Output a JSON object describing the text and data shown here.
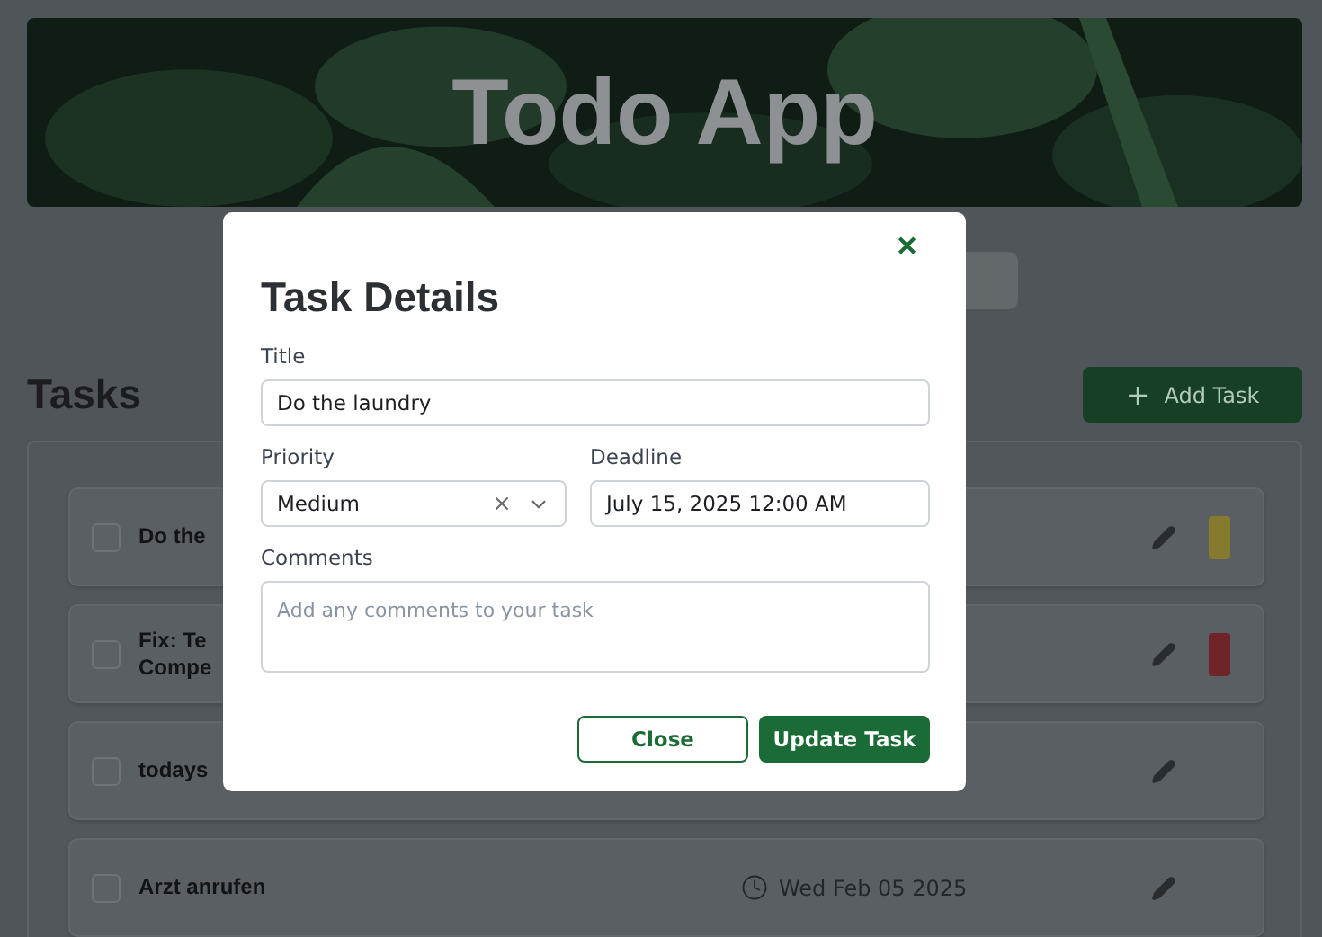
{
  "header": {
    "title": "Todo App"
  },
  "heading": "Tasks",
  "add_button": {
    "icon": "+",
    "label": "Add Task"
  },
  "tasks": [
    {
      "title_lines": [
        "Do the"
      ],
      "checked": false,
      "color": "#857a2e"
    },
    {
      "title_lines": [
        "Fix: Te",
        "Compe"
      ],
      "checked": false,
      "color": "#6e2428"
    },
    {
      "title_lines": [
        "todays"
      ],
      "checked": false
    },
    {
      "title_lines": [
        "Arzt anrufen"
      ],
      "checked": false,
      "date": "Wed Feb 05 2025"
    }
  ],
  "dialog": {
    "title": "Task Details",
    "close_icon": "✕",
    "title_field": {
      "label": "Title",
      "value": "Do the laundry"
    },
    "priority_field": {
      "label": "Priority",
      "value": "Medium"
    },
    "deadline_field": {
      "label": "Deadline",
      "value": "July 15, 2025 12:00 AM"
    },
    "comments_field": {
      "label": "Comments",
      "placeholder": "Add any comments to your task"
    },
    "buttons": [
      {
        "label": "Close",
        "kind": "outline"
      },
      {
        "label": "Update Task",
        "kind": "primary"
      }
    ]
  }
}
